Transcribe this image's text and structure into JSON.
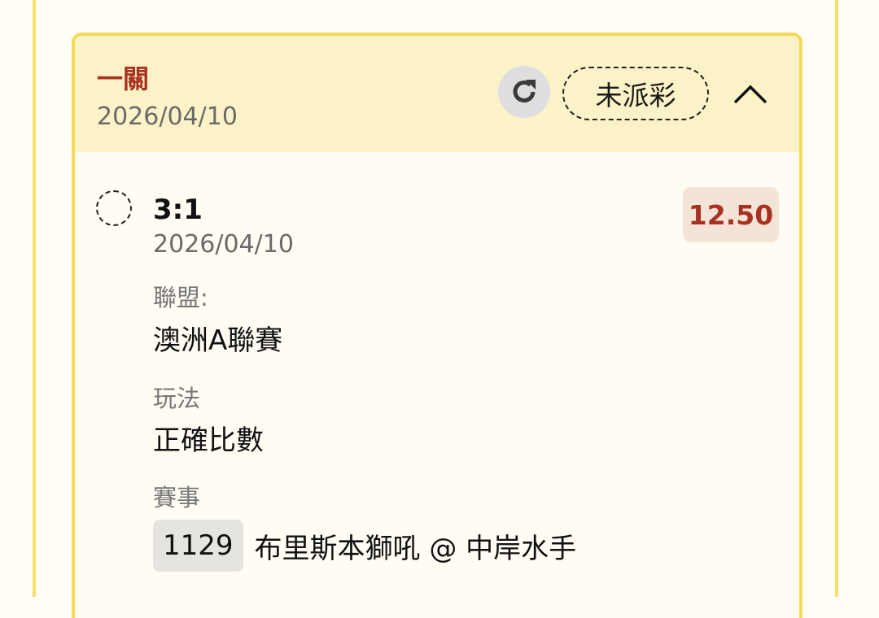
{
  "bet": {
    "type": "一關",
    "date": "2026/04/10",
    "status": "未派彩",
    "icons": {
      "refresh": "refresh-icon",
      "collapse": "chevron-up-icon"
    }
  },
  "selection": {
    "name": "3:1",
    "date": "2026/04/10",
    "odds": "12.50",
    "league_label": "聯盟:",
    "league_value": "澳洲A聯賽",
    "market_label": "玩法",
    "market_value": "正確比數",
    "event_label": "賽事",
    "event_number": "1129",
    "event_teams": "布里斯本獅吼 @ 中岸水手"
  },
  "colors": {
    "accent_red": "#a83222",
    "header_bg": "#fcf2c7",
    "border_yellow": "#f5d95a",
    "odds_bg": "#f4e4d8"
  }
}
